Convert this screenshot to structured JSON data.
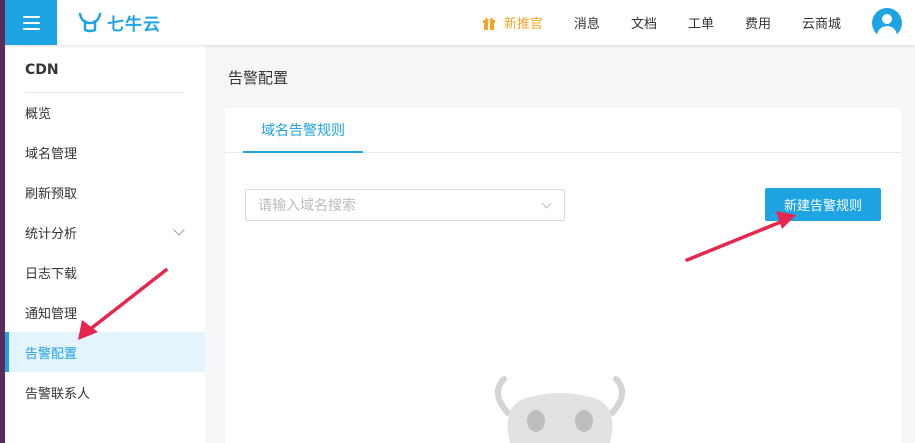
{
  "header": {
    "menu_icon": "hamburger-icon",
    "logo_text": "七牛云",
    "nav": [
      {
        "label": "新推官",
        "icon": "gift-icon"
      },
      {
        "label": "消息"
      },
      {
        "label": "文档"
      },
      {
        "label": "工单"
      },
      {
        "label": "费用"
      },
      {
        "label": "云商城"
      }
    ],
    "avatar_icon": "user-avatar-icon"
  },
  "sidebar": {
    "title": "CDN",
    "items": [
      {
        "label": "概览"
      },
      {
        "label": "域名管理"
      },
      {
        "label": "刷新预取"
      },
      {
        "label": "统计分析",
        "expandable": true
      },
      {
        "label": "日志下载"
      },
      {
        "label": "通知管理"
      },
      {
        "label": "告警配置",
        "active": true
      },
      {
        "label": "告警联系人"
      }
    ]
  },
  "main": {
    "title": "告警配置",
    "tabs": [
      {
        "label": "域名告警规则",
        "active": true
      }
    ],
    "search": {
      "placeholder": "请输入域名搜索"
    },
    "new_rule_button": "新建告警规则"
  },
  "colors": {
    "accent": "#1ea3e3",
    "promo": "#f5a623",
    "annotation_arrow": "#e8254e"
  }
}
